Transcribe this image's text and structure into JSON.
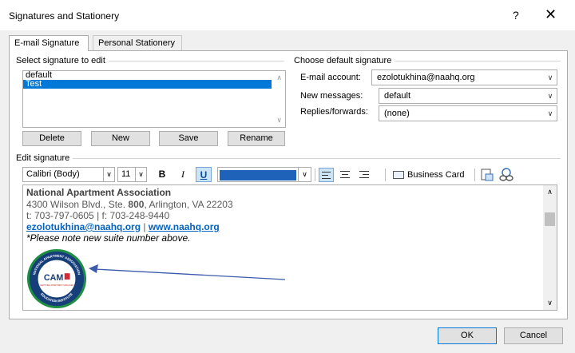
{
  "window": {
    "title": "Signatures and Stationery",
    "help_label": "?",
    "close_label": "✕"
  },
  "tabs": [
    {
      "label": "E-mail Signature",
      "active": true
    },
    {
      "label": "Personal Stationery",
      "active": false
    }
  ],
  "select_signature": {
    "group_label": "Select signature to edit",
    "items": [
      {
        "label": "default",
        "selected": false
      },
      {
        "label": "Test",
        "selected": true
      }
    ],
    "buttons": {
      "delete": "Delete",
      "new": "New",
      "save": "Save",
      "rename": "Rename"
    }
  },
  "default_signature": {
    "group_label": "Choose default signature",
    "email_account_label": "E-mail account:",
    "email_account_value": "ezolotukhina@naahq.org",
    "new_messages_label": "New messages:",
    "new_messages_value": "default",
    "replies_label": "Replies/forwards:",
    "replies_value": "(none)"
  },
  "edit_signature": {
    "group_label": "Edit signature",
    "toolbar": {
      "font_value": "Calibri (Body)",
      "size_value": "11",
      "bold_label": "B",
      "italic_label": "I",
      "underline_label": "U",
      "font_color": "#1e62b9",
      "business_card_label": "Business Card"
    },
    "content": {
      "line1": "National Apartment Association",
      "line2_prefix": "4300 Wilson Blvd., Ste. ",
      "line2_bold": "800",
      "line2_suffix": ", Arlington, VA 22203",
      "line3": "t: 703-797-0605 | f: 703-248-9440",
      "email_link": "ezolotukhina@naahq.org",
      "link_separator": " | ",
      "web_link": "www.naahq.org",
      "note": "*Please note new suite number above.",
      "logo_text": "CAM",
      "logo_ring_top": "NATIONAL APARTMENT ASSOCIATION",
      "logo_ring_bottom": "EDUCATION INSTITUTE",
      "logo_sub": "CERTIFIED APARTMENT MANAGER"
    }
  },
  "footer": {
    "ok_label": "OK",
    "cancel_label": "Cancel"
  },
  "colors": {
    "accent": "#0078d7",
    "link": "#0563c1",
    "annotation_arrow": "#3b5bab"
  }
}
